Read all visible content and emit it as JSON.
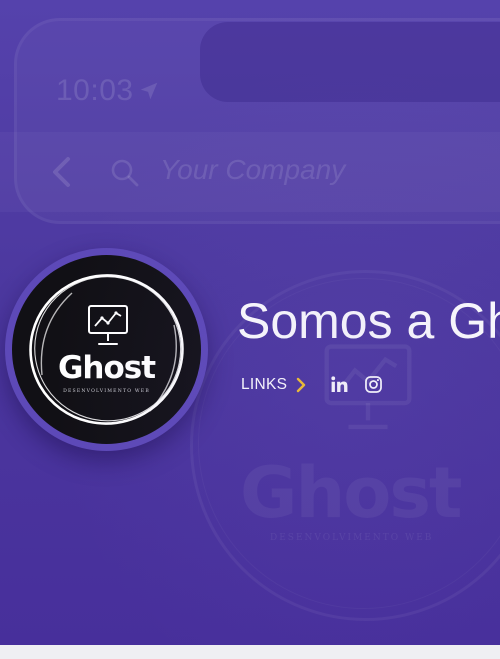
{
  "background_mock": {
    "time": "10:03",
    "search_placeholder": "Your Company"
  },
  "profile": {
    "title": "Somos a Ghost",
    "logo_word": "Ghost",
    "logo_tagline": "DESENVOLVIMENTO WEB",
    "links_label": "LINKS"
  },
  "icons": {
    "links_chevron": "chevron-right-icon",
    "social": [
      "linkedin-icon",
      "instagram-icon"
    ]
  },
  "colors": {
    "background": "#4c389f",
    "avatar_ring": "#5d49b8",
    "avatar_fill": "#111015",
    "chevron_accent": "#f5c22b",
    "text": "#ffffff",
    "bottom_strip": "#efeff3"
  }
}
